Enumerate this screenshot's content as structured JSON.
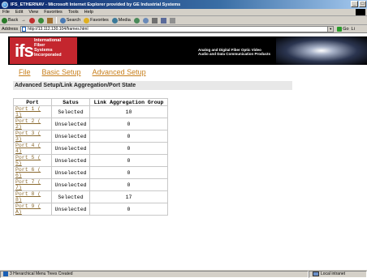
{
  "window": {
    "title": "IFS_ETHERNAV - Microsoft Internet Explorer provided by GE Industrial Systems",
    "buttons": [
      "_",
      "□"
    ]
  },
  "menu": [
    "File",
    "Edit",
    "View",
    "Favorites",
    "Tools",
    "Help"
  ],
  "toolbar": {
    "back": "Back",
    "forward": "→",
    "search": "Search",
    "favorites": "Favorites",
    "media": "Media"
  },
  "address": {
    "label": "Address",
    "url": "http://13.112.130.104/frames.html",
    "go": "Go",
    "links": "Li"
  },
  "banner": {
    "logo": "ifs",
    "logo_words": [
      "International",
      "Fiber",
      "Systems",
      "Incorporated"
    ],
    "tagline": [
      "Analog and Digital Fiber Optic Video",
      "Audio and Data Communication Products"
    ]
  },
  "nav": [
    "File",
    "Basic Setup",
    "Advanced Setup"
  ],
  "section_title": "Advanced Setup/Link Aggregation/Port State",
  "table": {
    "headers": [
      "Port",
      "Satus",
      "Link Aggregation Group"
    ],
    "rows": [
      {
        "port": "Port 1 ( 1)",
        "status": "Selected",
        "lag": "10"
      },
      {
        "port": "Port 2 ( 2)",
        "status": "Unselected",
        "lag": "0"
      },
      {
        "port": "Port 3 ( 3)",
        "status": "Unselected",
        "lag": "0"
      },
      {
        "port": "Port 4 ( 4)",
        "status": "Unselected",
        "lag": "0"
      },
      {
        "port": "Port 5 ( 5)",
        "status": "Unselected",
        "lag": "0"
      },
      {
        "port": "Port 6 ( 6)",
        "status": "Unselected",
        "lag": "0"
      },
      {
        "port": "Port 7 ( 7)",
        "status": "Unselected",
        "lag": "0"
      },
      {
        "port": "Port 8 ( 8)",
        "status": "Selected",
        "lag": "17"
      },
      {
        "port": "Port 9 ( A)",
        "status": "Unselected",
        "lag": "0"
      }
    ]
  },
  "status": {
    "left": "3 Hierarchical Menu Trees Created",
    "zone": "Local intranet"
  },
  "colors": {
    "link": "#c8801e",
    "logo_red": "#c4262e",
    "chrome": "#d4d0c8"
  }
}
